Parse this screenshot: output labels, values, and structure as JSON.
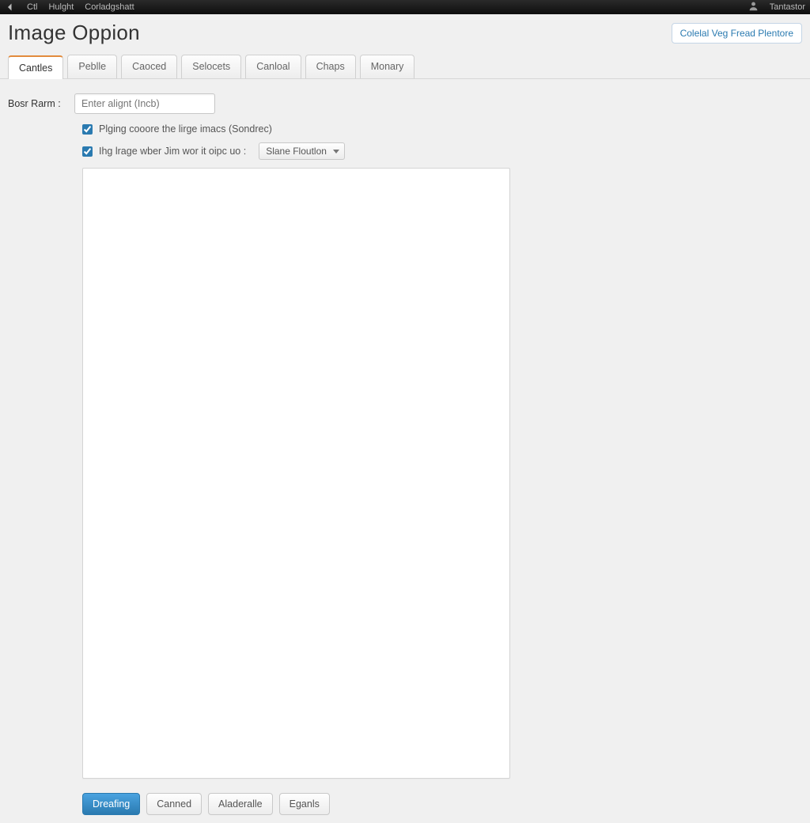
{
  "topbar": {
    "items": [
      "Ctl",
      "Hulght",
      "Corladgshatt"
    ],
    "right": "Tantastor"
  },
  "header": {
    "title": "Image Oppion",
    "action_label": "Colelal Veg  Fread Plentore"
  },
  "tabs": [
    {
      "label": "Cantles",
      "active": true
    },
    {
      "label": "Peblle",
      "active": false
    },
    {
      "label": "Caoced",
      "active": false
    },
    {
      "label": "Selocets",
      "active": false
    },
    {
      "label": "Canloal",
      "active": false
    },
    {
      "label": "Chaps",
      "active": false
    },
    {
      "label": "Monary",
      "active": false
    }
  ],
  "form": {
    "field_label": "Bosr Rarm :",
    "field_placeholder": "Enter alignt (Incb)",
    "chk1_label": "Plging cooore the lirge imacs (Sondrec)",
    "chk2_label": "Ihg lrage wber Jim wor it oipc uo :",
    "select_value": "Slane Floutlon"
  },
  "footer": {
    "primary": "Dreafing",
    "b2": "Canned",
    "b3": "Aladeralle",
    "b4": "Eganls"
  }
}
